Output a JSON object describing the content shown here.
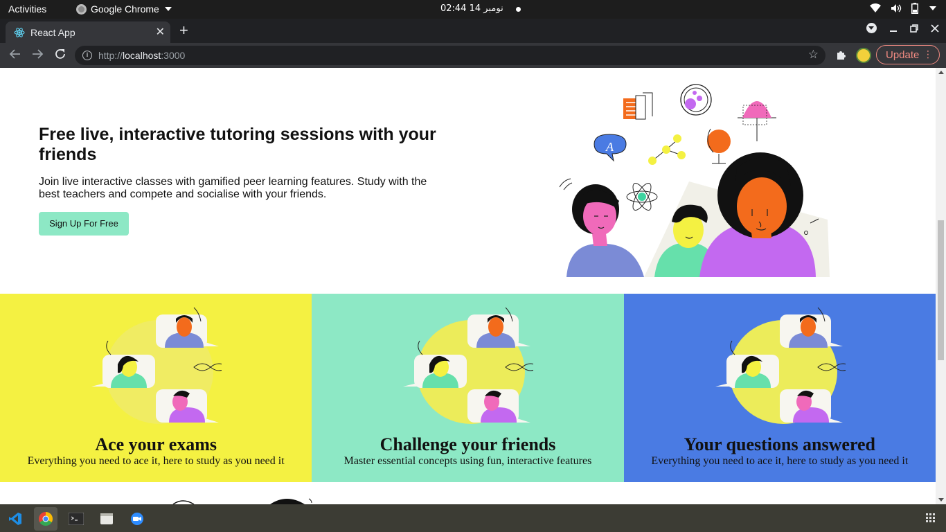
{
  "system_bar": {
    "activities": "Activities",
    "app_name": "Google Chrome",
    "clock": "نومبر 14  02:44"
  },
  "browser": {
    "tab_title": "React App",
    "url_scheme": "http://",
    "url_host": "localhost",
    "url_port": ":3000",
    "update_label": "Update"
  },
  "hero": {
    "title": "Free live, interactive tutoring sessions with your friends",
    "description": "Join live interactive classes with gamified peer learning features. Study with the best teachers and compete and socialise with your friends.",
    "cta_label": "Sign Up For Free"
  },
  "features": [
    {
      "title": "Ace your exams",
      "subtitle": "Everything you need to ace it, here to study as you need it",
      "bg": "#f4f142"
    },
    {
      "title": "Challenge your friends",
      "subtitle": "Master essential concepts using fun, interactive features",
      "bg": "#8de8c5"
    },
    {
      "title": "Your questions answered",
      "subtitle": "Everything you need to ace it, here to study as you need it",
      "bg": "#4a7be3"
    }
  ],
  "colors": {
    "accent_mint": "#8de8c5",
    "accent_yellow": "#f4f142",
    "accent_blue": "#4a7be3",
    "accent_orange": "#f36b1c",
    "accent_purple": "#c369f0",
    "accent_pink": "#f06aba"
  },
  "dock": {
    "icons": [
      "vscode-icon",
      "chrome-icon",
      "terminal-icon",
      "files-icon",
      "zoom-icon"
    ]
  }
}
